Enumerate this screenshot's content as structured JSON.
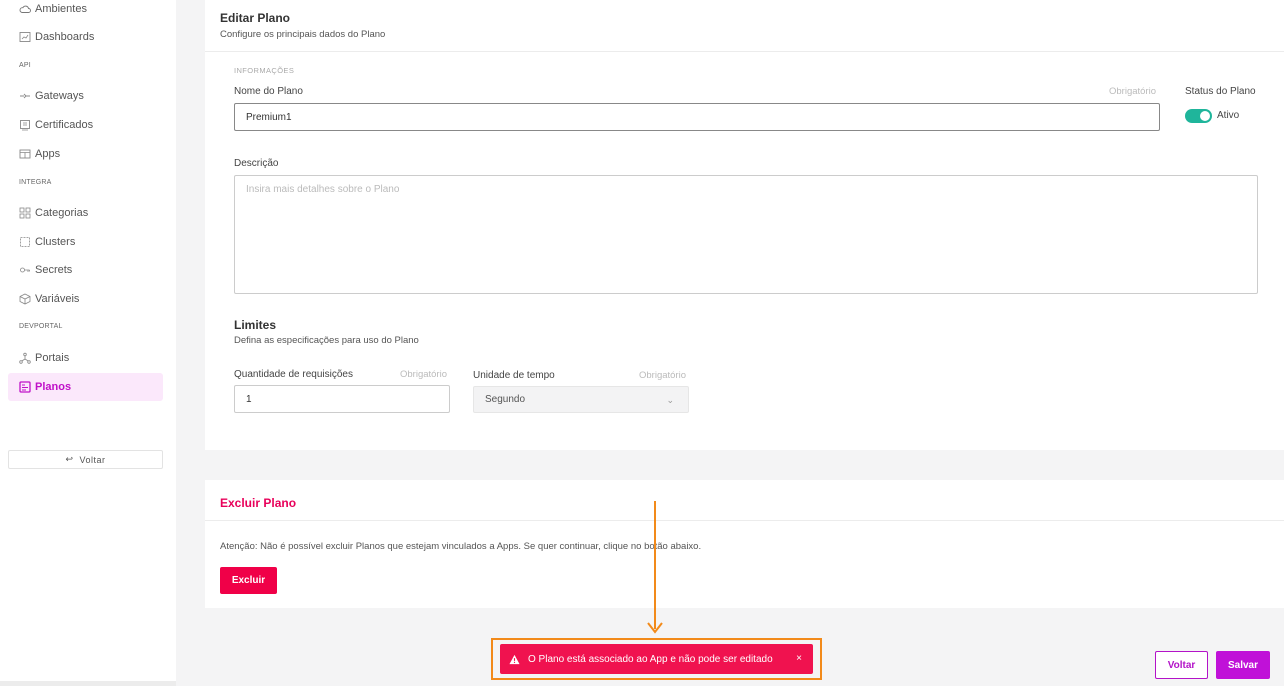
{
  "sidebar": {
    "items": [
      {
        "label": "Ambientes",
        "icon": "cloud-icon"
      },
      {
        "label": "Dashboards",
        "icon": "dashboard-icon"
      },
      {
        "label": "Gateways",
        "icon": "gateway-icon"
      },
      {
        "label": "Certificados",
        "icon": "certificate-icon"
      },
      {
        "label": "Apps",
        "icon": "apps-icon"
      },
      {
        "label": "Categorias",
        "icon": "categories-icon"
      },
      {
        "label": "Clusters",
        "icon": "clusters-icon"
      },
      {
        "label": "Secrets",
        "icon": "secrets-icon"
      },
      {
        "label": "Variáveis",
        "icon": "variables-icon"
      },
      {
        "label": "Portais",
        "icon": "portals-icon"
      },
      {
        "label": "Planos",
        "icon": "plans-icon"
      }
    ],
    "sections": [
      "API",
      "INTEGRA",
      "DEVPORTAL"
    ],
    "back_label": "Voltar",
    "active_color": "#c011c8"
  },
  "edit": {
    "title": "Editar Plano",
    "subtitle": "Configure os principais dados do Plano",
    "section_caption": "INFORMAÇÕES",
    "name_label": "Nome do Plano",
    "required_hint": "Obrigatório",
    "name_value": "Premium1",
    "status_label": "Status do Plano",
    "status_value": "Ativo",
    "description_label": "Descrição",
    "description_placeholder": "Insira mais detalhes sobre o Plano"
  },
  "limits": {
    "title": "Limites",
    "subtitle": "Defina as especificações para uso do Plano",
    "requests_label": "Quantidade de requisições",
    "requests_value": "1",
    "time_unit_label": "Unidade de tempo",
    "time_unit_value": "Segundo",
    "required_hint": "Obrigatório"
  },
  "delete": {
    "title": "Excluir Plano",
    "text": "Atenção: Não é possível excluir Planos que estejam vinculados a Apps. Se quer continuar, clique no botão abaixo.",
    "button": "Excluir"
  },
  "toast": {
    "message": "O Plano está associado ao App e não pode ser editado",
    "close": "×"
  },
  "footer": {
    "back_button": "Voltar",
    "save_button": "Salvar"
  },
  "colors": {
    "brand": "#c011d8",
    "danger": "#f00048",
    "toggle_on": "#1fb59b",
    "highlight": "#f28a1a"
  }
}
